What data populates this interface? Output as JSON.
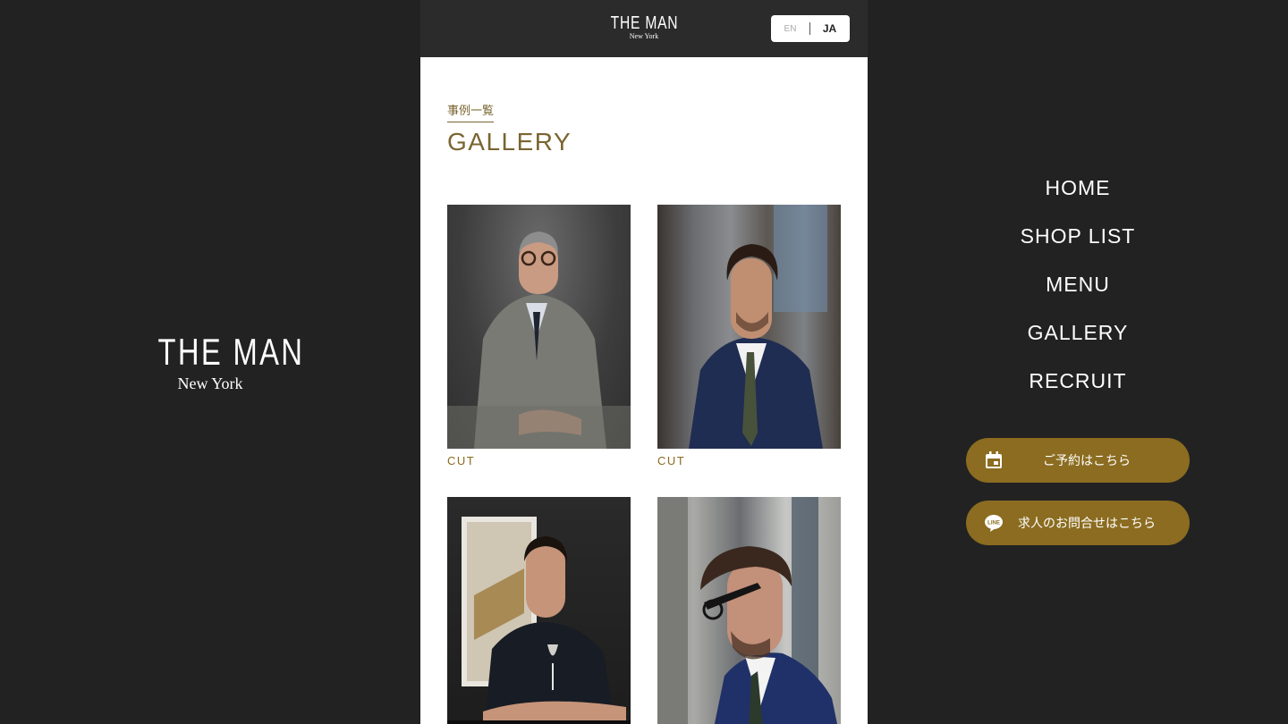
{
  "brand": {
    "name": "THE MAN",
    "city": "New York"
  },
  "language": {
    "en": "EN",
    "ja": "JA"
  },
  "page": {
    "subtitle": "事例一覧",
    "title": "GALLERY"
  },
  "gallery": [
    {
      "caption": "CUT"
    },
    {
      "caption": "CUT"
    },
    {
      "caption": ""
    },
    {
      "caption": ""
    }
  ],
  "nav": [
    "HOME",
    "SHOP LIST",
    "MENU",
    "GALLERY",
    "RECRUIT"
  ],
  "cta": {
    "reserve": "ご予約はこちら",
    "recruit": "求人のお問合せはこちら",
    "line_badge": "LINE"
  },
  "colors": {
    "gold": "#8b6c20",
    "dark": "#222222",
    "title": "#7a6531"
  }
}
